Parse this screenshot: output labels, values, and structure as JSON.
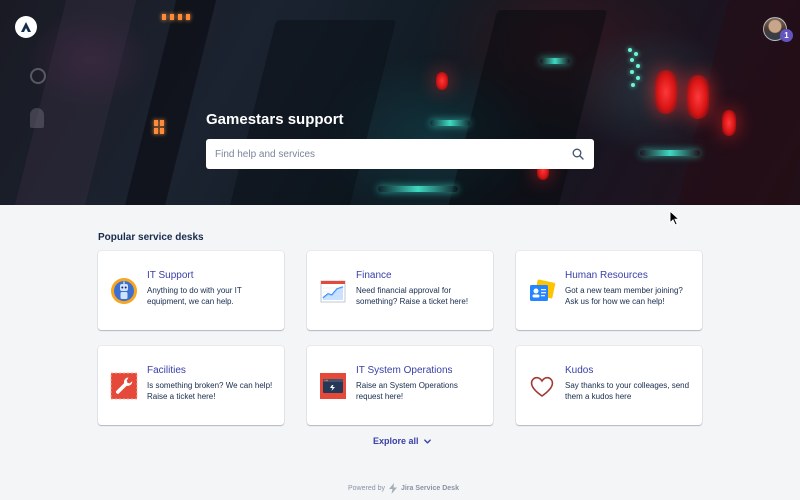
{
  "hero": {
    "title": "Gamestars support",
    "search_placeholder": "Find help and services",
    "avatar_badge": "1"
  },
  "popular": {
    "heading": "Popular service desks",
    "cards": [
      {
        "title": "IT Support",
        "desc": "Anything to do with your IT equipment, we can help.",
        "icon": "robot-icon"
      },
      {
        "title": "Finance",
        "desc": "Need financial approval for something? Raise a ticket here!",
        "icon": "chart-icon"
      },
      {
        "title": "Human Resources",
        "desc": "Got a new team member joining? Ask us for how we can help!",
        "icon": "id-badge-icon"
      },
      {
        "title": "Facilities",
        "desc": "Is something broken? We can help! Raise a ticket here!",
        "icon": "wrench-icon"
      },
      {
        "title": "IT System Operations",
        "desc": "Raise an System Operations request here!",
        "icon": "terminal-icon"
      },
      {
        "title": "Kudos",
        "desc": "Say thanks to your colleages, send them a kudos here",
        "icon": "heart-icon"
      }
    ],
    "explore_label": "Explore all"
  },
  "footer": {
    "powered_by": "Powered by",
    "brand": "Jira Service Desk"
  },
  "colors": {
    "link": "#3940a8",
    "text": "#172b4d",
    "page_bg": "#f4f5f7",
    "badge": "#6554c0"
  }
}
